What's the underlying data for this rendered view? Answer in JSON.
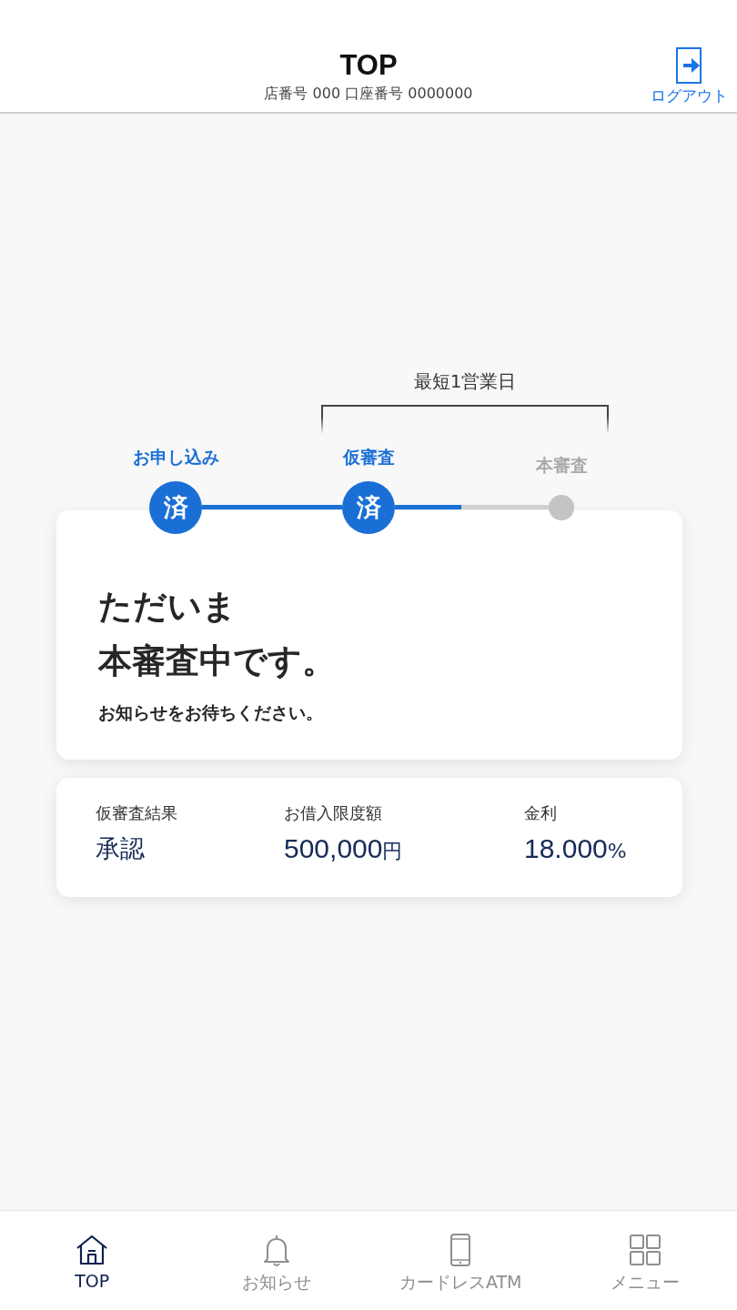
{
  "header": {
    "title": "TOP",
    "account_line": "店番号 000 口座番号 0000000",
    "logout_label": "ログアウト"
  },
  "progress": {
    "bracket_label": "最短1営業日",
    "level": 0.43,
    "steps": [
      {
        "label": "お申し込み",
        "done": true,
        "mark": "済"
      },
      {
        "label": "仮審査",
        "done": true,
        "mark": "済"
      },
      {
        "label": "本審査",
        "done": false
      }
    ]
  },
  "status_card": {
    "heading_lines": [
      "ただいま",
      "本審査中です。"
    ],
    "message": "お知らせをお待ちください。"
  },
  "summary": [
    {
      "label": "仮審査結果",
      "value": "承認"
    },
    {
      "label": "お借入限度額",
      "value": "500,000",
      "unit": "円"
    },
    {
      "label": "金利",
      "value": "18.000",
      "unit": "%"
    }
  ],
  "tab_bar": [
    {
      "kind": "home",
      "label": "TOP",
      "selected": true
    },
    {
      "kind": "bell",
      "label": "お知らせ",
      "selected": false
    },
    {
      "kind": "phone",
      "label": "カードレスATM",
      "selected": false
    },
    {
      "kind": "grid",
      "label": "メニュー",
      "selected": false
    }
  ]
}
